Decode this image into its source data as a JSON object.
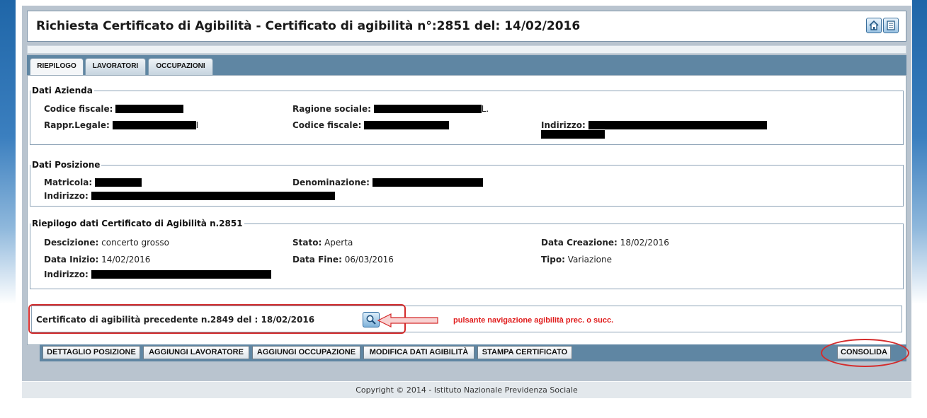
{
  "header": {
    "title": "Richiesta Certificato di Agibilità - Certificato di agibilità n°:2851 del: 14/02/2016",
    "home_icon": "home-icon",
    "doc_icon": "document-icon"
  },
  "tabs": [
    {
      "label": "RIEPILOGO",
      "active": true
    },
    {
      "label": "LAVORATORI",
      "active": false
    },
    {
      "label": "OCCUPAZIONI",
      "active": false
    }
  ],
  "dati_azienda": {
    "legend": "Dati Azienda",
    "codice_fiscale_label": "Codice fiscale:",
    "ragione_sociale_label": "Ragione sociale:",
    "ragione_sociale_suffix": "L.",
    "rappr_legale_label": "Rappr.Legale:",
    "rappr_legale_suffix": "I",
    "codice_fiscale2_label": "Codice fiscale:",
    "indirizzo_label": "Indirizzo:"
  },
  "dati_posizione": {
    "legend": "Dati Posizione",
    "matricola_label": "Matricola:",
    "denominazione_label": "Denominazione:",
    "indirizzo_label": "Indirizzo:"
  },
  "riepilogo": {
    "legend": "Riepilogo dati Certificato di Agibilità n.2851",
    "descrizione_label": "Descizione:",
    "descrizione_value": "concerto grosso",
    "stato_label": "Stato:",
    "stato_value": "Aperta",
    "data_creazione_label": "Data Creazione:",
    "data_creazione_value": "18/02/2016",
    "data_inizio_label": "Data Inizio:",
    "data_inizio_value": "14/02/2016",
    "data_fine_label": "Data Fine:",
    "data_fine_value": "06/03/2016",
    "tipo_label": "Tipo:",
    "tipo_value": "Variazione",
    "indirizzo_label": "Indirizzo:"
  },
  "navigation": {
    "label": "Certificato di agibilità precedente n.2849 del : 18/02/2016",
    "button_icon": "search-icon",
    "annotation": "pulsante navigazione agibilità prec. o succ."
  },
  "buttons": {
    "dettaglio": "DETTAGLIO POSIZIONE",
    "aggiungi_lavoratore": "AGGIUNGI LAVORATORE",
    "aggiungi_occupazione": "AGGIUNGI OCCUPAZIONE",
    "modifica": "MODIFICA DATI AGIBILITÀ",
    "stampa": "STAMPA CERTIFICATO",
    "consolida": "CONSOLIDA"
  },
  "footer": {
    "text": "Copyright © 2014 - Istituto Nazionale Previdenza Sociale"
  },
  "colors": {
    "tab_bar": "#5f86a3",
    "annotation_red": "#d42b2b",
    "frame": "#b9c4cf"
  }
}
